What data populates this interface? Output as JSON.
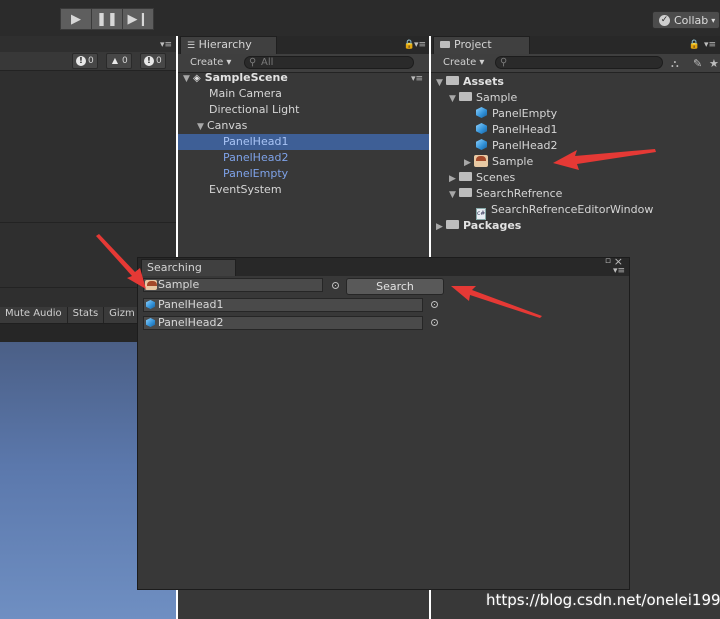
{
  "toolbar": {
    "play_icon": "play-icon",
    "pause_icon": "pause-icon",
    "step_icon": "step-icon",
    "collab_label": "Collab"
  },
  "scene": {
    "badges": [
      "0",
      "0",
      "0"
    ],
    "game_bar": [
      "Mute Audio",
      "Stats",
      "Gizm"
    ]
  },
  "hierarchy": {
    "tab_label": "Hierarchy",
    "create_label": "Create",
    "search_placeholder": "All",
    "scene_name": "SampleScene",
    "items": [
      {
        "label": "Main Camera",
        "selected": false
      },
      {
        "label": "Directional Light",
        "selected": false
      },
      {
        "label": "Canvas",
        "selected": false
      },
      {
        "label": "PanelHead1",
        "selected": true
      },
      {
        "label": "PanelHead2",
        "selected": false
      },
      {
        "label": "PanelEmpty",
        "selected": false
      },
      {
        "label": "EventSystem",
        "selected": false
      }
    ]
  },
  "project": {
    "tab_label": "Project",
    "create_label": "Create",
    "tree": [
      {
        "label": "Assets",
        "icon": "folder-icon"
      },
      {
        "label": "Sample",
        "icon": "folder-icon"
      },
      {
        "label": "PanelEmpty",
        "icon": "prefab-icon"
      },
      {
        "label": "PanelHead1",
        "icon": "prefab-icon"
      },
      {
        "label": "PanelHead2",
        "icon": "prefab-icon"
      },
      {
        "label": "Sample",
        "icon": "sprite-icon"
      },
      {
        "label": "Scenes",
        "icon": "folder-icon"
      },
      {
        "label": "SearchRefrence",
        "icon": "folder-icon"
      },
      {
        "label": "SearchRefrenceEditorWindow",
        "icon": "script-icon"
      },
      {
        "label": "Packages",
        "icon": "folder-icon"
      }
    ]
  },
  "searching": {
    "tab_label": "Searching",
    "object_field_value": "Sample",
    "search_button": "Search",
    "results": [
      "PanelHead1",
      "PanelHead2"
    ]
  },
  "watermark": "https://blog.csdn.net/onelei1994",
  "colors": {
    "selection": "#3e5f96",
    "annotation_arrow": "#e53935"
  }
}
